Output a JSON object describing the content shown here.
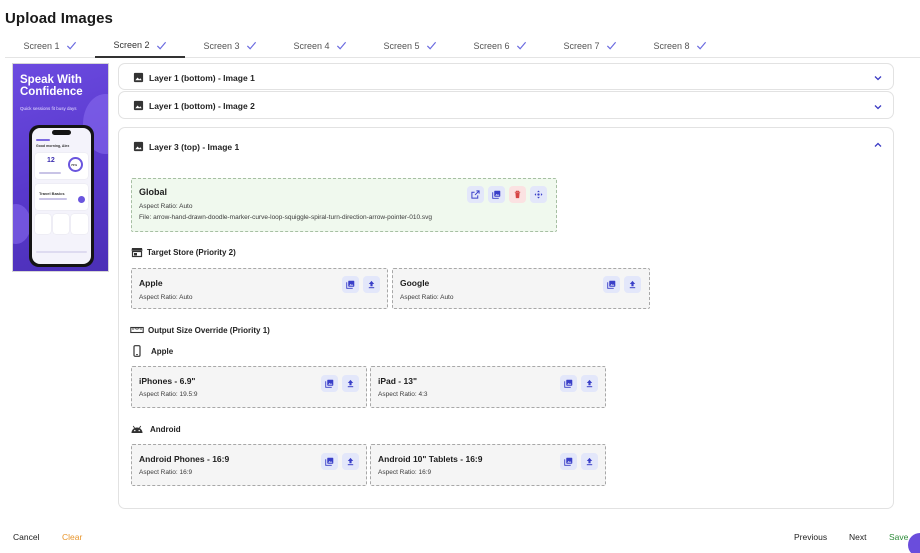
{
  "page": {
    "title": "Upload Images"
  },
  "tabs": [
    {
      "label": "Screen 1"
    },
    {
      "label": "Screen 2"
    },
    {
      "label": "Screen 3"
    },
    {
      "label": "Screen 4"
    },
    {
      "label": "Screen 5"
    },
    {
      "label": "Screen 6"
    },
    {
      "label": "Screen 7"
    },
    {
      "label": "Screen 8"
    }
  ],
  "preview": {
    "headline": "Speak With Confidence",
    "subheadline": "Quick sessions fit busy days",
    "phone": {
      "greeting": "Good morning, Alex",
      "score": "12",
      "progress": "70%",
      "card_title": "Travel Basics"
    }
  },
  "layers": [
    {
      "title": "Layer 1 (bottom) - Image 1"
    },
    {
      "title": "Layer 1 (bottom) - Image 2"
    },
    {
      "title": "Layer 3 (top) - Image 1"
    }
  ],
  "global": {
    "title": "Global",
    "aspect": "Aspect Ratio: Auto",
    "file": "File: arrow-hand-drawn-doodle-marker-curve-loop-squiggle-spiral-turn-direction-arrow-pointer-010.svg"
  },
  "target_store": {
    "heading": "Target Store (Priority 2)",
    "cards": [
      {
        "title": "Apple",
        "aspect": "Aspect Ratio: Auto"
      },
      {
        "title": "Google",
        "aspect": "Aspect Ratio: Auto"
      }
    ]
  },
  "output_size": {
    "heading": "Output Size Override (Priority 1)",
    "apple": {
      "label": "Apple",
      "cards": [
        {
          "title": "iPhones - 6.9\"",
          "aspect": "Aspect Ratio: 19.5:9"
        },
        {
          "title": "iPad - 13\"",
          "aspect": "Aspect Ratio: 4:3"
        }
      ]
    },
    "android": {
      "label": "Android",
      "cards": [
        {
          "title": "Android Phones - 16:9",
          "aspect": "Aspect Ratio: 16:9"
        },
        {
          "title": "Android 10\" Tablets - 16:9",
          "aspect": "Aspect Ratio: 16:9"
        }
      ]
    }
  },
  "footer": {
    "cancel": "Cancel",
    "clear": "Clear",
    "previous": "Previous",
    "next": "Next",
    "save": "Save"
  },
  "colors": {
    "accent": "#4a3fcf",
    "save": "#2e8b3a",
    "clear": "#e8952b",
    "delete": "#d64545",
    "global_bg": "#f0f9ee"
  }
}
